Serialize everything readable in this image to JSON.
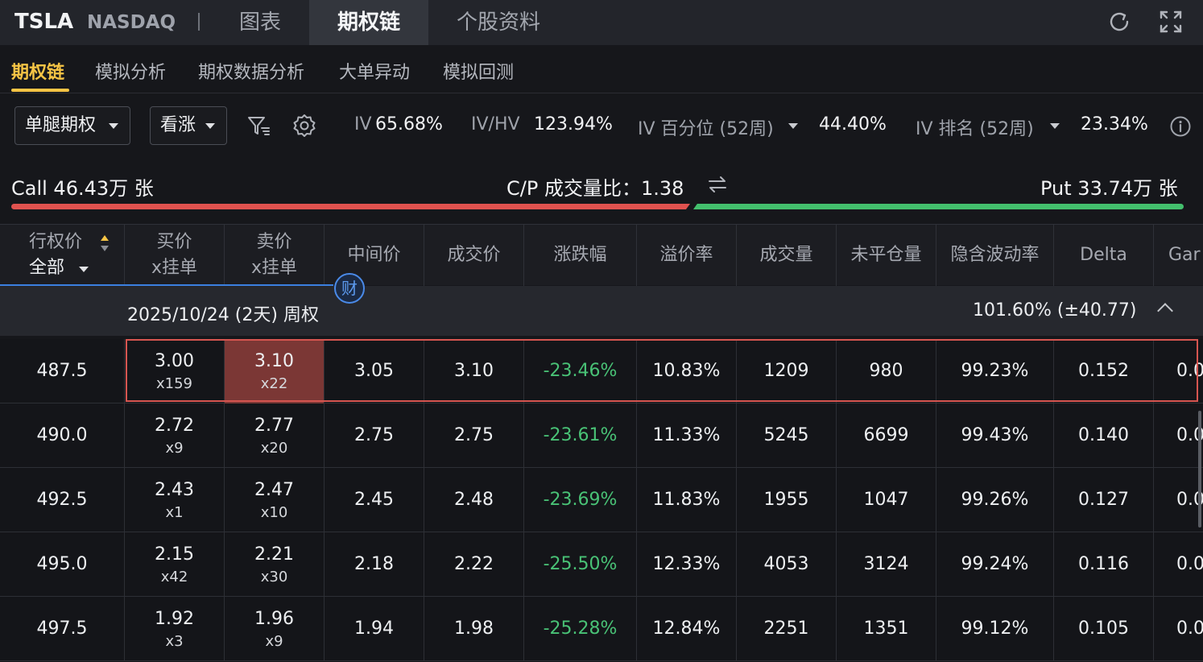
{
  "header": {
    "ticker": "TSLA",
    "exchange": "NASDAQ",
    "tabs": [
      {
        "label": "图表",
        "active": false
      },
      {
        "label": "期权链",
        "active": true
      },
      {
        "label": "个股资料",
        "active": false
      }
    ],
    "icons": [
      "refresh-icon",
      "fullscreen-icon"
    ]
  },
  "subtabs": [
    {
      "label": "期权链",
      "active": true
    },
    {
      "label": "模拟分析",
      "active": false
    },
    {
      "label": "期权数据分析",
      "active": false
    },
    {
      "label": "大单异动",
      "active": false
    },
    {
      "label": "模拟回测",
      "active": false
    }
  ],
  "filters": {
    "strategy": "单腿期权",
    "direction": "看涨",
    "icons": [
      "filter-icon",
      "settings-icon"
    ]
  },
  "stats": {
    "iv_label": "IV",
    "iv_value": "65.68%",
    "ivhv_label": "IV/HV",
    "ivhv_value": "123.94%",
    "iv_pct_label": "IV 百分位 (52周)",
    "iv_pct_value": "44.40%",
    "iv_rank_label": "IV 排名 (52周)",
    "iv_rank_value": "23.34%",
    "info_icon": "info-icon"
  },
  "volume": {
    "call_text": "Call 46.43万 张",
    "ratio_text": "C/P 成交量比：1.38",
    "put_text": "Put 33.74万 张",
    "swap_icon": "swap-icon",
    "call_color": "#e0524f",
    "put_color": "#43bf6d"
  },
  "table": {
    "headers": {
      "strike": "行权价",
      "strike_filter": "全部",
      "bid": "买价",
      "bid_sub": "x挂单",
      "ask": "卖价",
      "ask_sub": "x挂单",
      "mid": "中间价",
      "last": "成交价",
      "change": "涨跌幅",
      "premium": "溢价率",
      "volume": "成交量",
      "oi": "未平仓量",
      "iv": "隐含波动率",
      "delta": "Delta",
      "gamma": "Gar"
    },
    "badge": "财",
    "group": {
      "date": "2025/10/24 (2天) 周权",
      "iv": "101.60%  (±40.77)"
    },
    "rows": [
      {
        "strike": "487.5",
        "bid": "3.00",
        "bid_size": "x159",
        "ask": "3.10",
        "ask_size": "x22",
        "mid": "3.05",
        "last": "3.10",
        "change": "-23.46%",
        "premium": "10.83%",
        "volume": "1209",
        "oi": "980",
        "iv": "99.23%",
        "delta": "0.152",
        "gamma": "0.0"
      },
      {
        "strike": "490.0",
        "bid": "2.72",
        "bid_size": "x9",
        "ask": "2.77",
        "ask_size": "x20",
        "mid": "2.75",
        "last": "2.75",
        "change": "-23.61%",
        "premium": "11.33%",
        "volume": "5245",
        "oi": "6699",
        "iv": "99.43%",
        "delta": "0.140",
        "gamma": "0.0"
      },
      {
        "strike": "492.5",
        "bid": "2.43",
        "bid_size": "x1",
        "ask": "2.47",
        "ask_size": "x10",
        "mid": "2.45",
        "last": "2.48",
        "change": "-23.69%",
        "premium": "11.83%",
        "volume": "1955",
        "oi": "1047",
        "iv": "99.26%",
        "delta": "0.127",
        "gamma": "0.0"
      },
      {
        "strike": "495.0",
        "bid": "2.15",
        "bid_size": "x42",
        "ask": "2.21",
        "ask_size": "x30",
        "mid": "2.18",
        "last": "2.22",
        "change": "-25.50%",
        "premium": "12.33%",
        "volume": "4053",
        "oi": "3124",
        "iv": "99.24%",
        "delta": "0.116",
        "gamma": "0.0"
      },
      {
        "strike": "497.5",
        "bid": "1.92",
        "bid_size": "x3",
        "ask": "1.96",
        "ask_size": "x9",
        "mid": "1.94",
        "last": "1.98",
        "change": "-25.28%",
        "premium": "12.84%",
        "volume": "2251",
        "oi": "1351",
        "iv": "99.12%",
        "delta": "0.105",
        "gamma": "0.0"
      }
    ],
    "colors": {
      "accent_tab": "#f6c445",
      "negative": "#49c276",
      "highlight_border": "#d65550",
      "ask_highlight": "#7b3735"
    }
  }
}
